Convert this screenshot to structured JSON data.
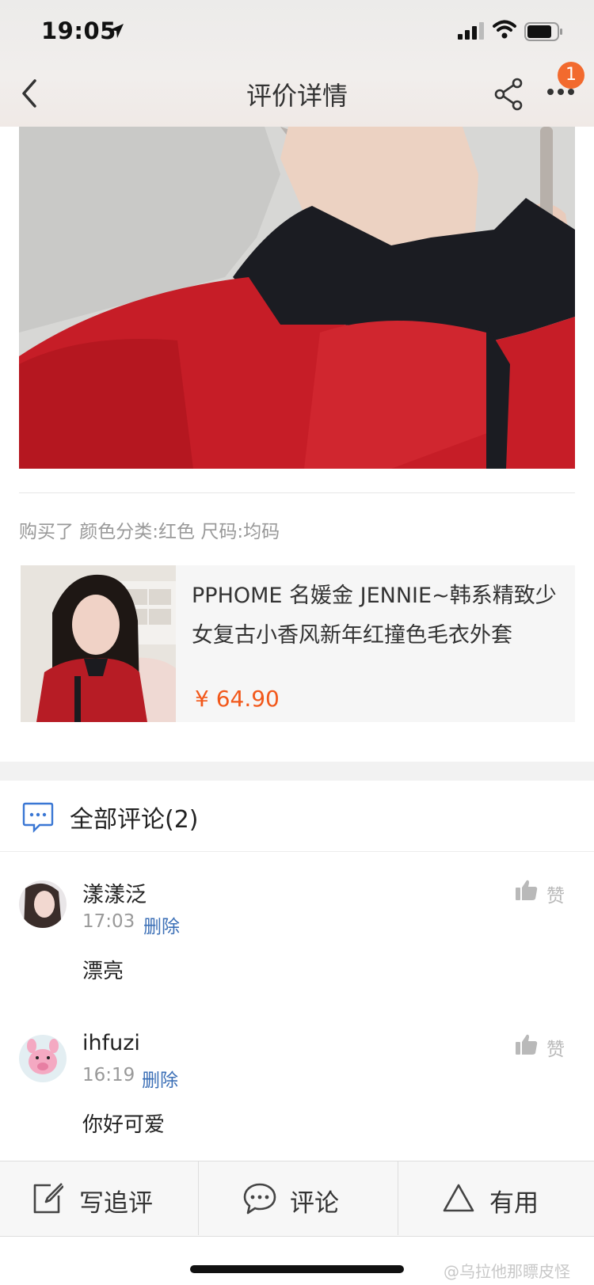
{
  "status_bar": {
    "time": "19:05"
  },
  "nav": {
    "title": "评价详情",
    "notification_count": "1"
  },
  "review": {
    "purchase_info": "购买了 颜色分类:红色 尺码:均码"
  },
  "product": {
    "title": "PPHOME 名媛金 JENNIE~韩系精致少女复古小香风新年红撞色毛衣外套",
    "price": "¥ 64.90"
  },
  "comments_section": {
    "header": "全部评论(2)"
  },
  "comments": [
    {
      "name": "漾漾泛",
      "time": "17:03",
      "delete_label": "删除",
      "text": "漂亮",
      "like_label": "赞"
    },
    {
      "name": "ihfuzi",
      "time": "16:19",
      "delete_label": "删除",
      "text": "你好可爱",
      "like_label": "赞"
    }
  ],
  "bottom_bar": {
    "write_followup": "写追评",
    "comment": "评论",
    "useful": "有用"
  },
  "watermark": "@乌拉他那瞟皮怪",
  "colors": {
    "price": "#f2581b",
    "badge": "#f26a2e",
    "delete_link": "#3b6fb6",
    "comment_icon": "#3a77d4"
  }
}
